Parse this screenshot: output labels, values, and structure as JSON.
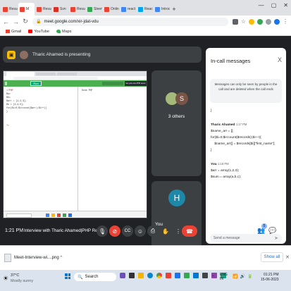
{
  "tabs": [
    {
      "label": "Resum",
      "color": "#ea4335"
    },
    {
      "label": "M",
      "color": "#ea4335",
      "active": true
    },
    {
      "label": "Resum",
      "color": "#ea4335"
    },
    {
      "label": "Svn ",
      "color": "#d93025"
    },
    {
      "label": "Resum",
      "color": "#ea4335"
    },
    {
      "label": "Sleen",
      "color": "#34a853"
    },
    {
      "label": "Onlin",
      "color": "#ea4335"
    },
    {
      "label": "react",
      "color": "#4285f4"
    },
    {
      "label": "React",
      "color": "#00a4ef"
    },
    {
      "label": "Introc",
      "color": "#4285f4"
    }
  ],
  "browser": {
    "url": "meet.google.com/xir-jdat-vdu",
    "bookmarks": [
      "Gmail",
      "YouTube",
      "Maps"
    ]
  },
  "meeting": {
    "presenting_text": "Tharic Ahamed is presenting",
    "others_label": "3 others",
    "others_avatar_letter": "S",
    "you_label": "You",
    "you_avatar_letter": "H",
    "time": "1:21 PM",
    "title": "Interview with Tharic Ahamed|PHP Rea...",
    "badge_count": "5"
  },
  "chat": {
    "title": "In-call messages",
    "notice": "Messages can only be seen by people in the call and are deleted when the call ends",
    "lines_top": [
      "}"
    ],
    "msg1_name": "Tharic Ahamed",
    "msg1_time": "1:17 PM",
    "msg1_lines": [
      "$name_arr = [];",
      "for($i=0;$i<count($records);$i++){",
      "    $name_arr[] = $records[$i][\"first_name\"];",
      "}"
    ],
    "msg2_name": "You",
    "msg2_time": "1:18 PM",
    "msg2_lines": [
      "$arr = array(1,2,3);",
      "$sum = array(a,b,c);"
    ],
    "input_placeholder": "Send a message"
  },
  "shared_screen": {
    "run_label": "Run",
    "code_lines": [
      "<?PHP",
      "$a=",
      "$b=",
      "$arr = [1,2,3];",
      "$b = [3,4,5];",
      "for($i=0;$i<count($arr);$i++){",
      "}",
      "",
      "",
      "",
      "?>"
    ],
    "output_label": "Output",
    "output_text": "Done PHP",
    "right_btn": "Get your own PHP server"
  },
  "download": {
    "file_name": "Meet-Interview-wi....png",
    "show_all": "Show all"
  },
  "taskbar": {
    "weather_temp": "37°C",
    "weather_desc": "Mostly sunny",
    "search_label": "Search",
    "lang": "ENG",
    "region": "IN",
    "clock_time": "01:21 PM",
    "clock_date": "15-06-2023"
  }
}
